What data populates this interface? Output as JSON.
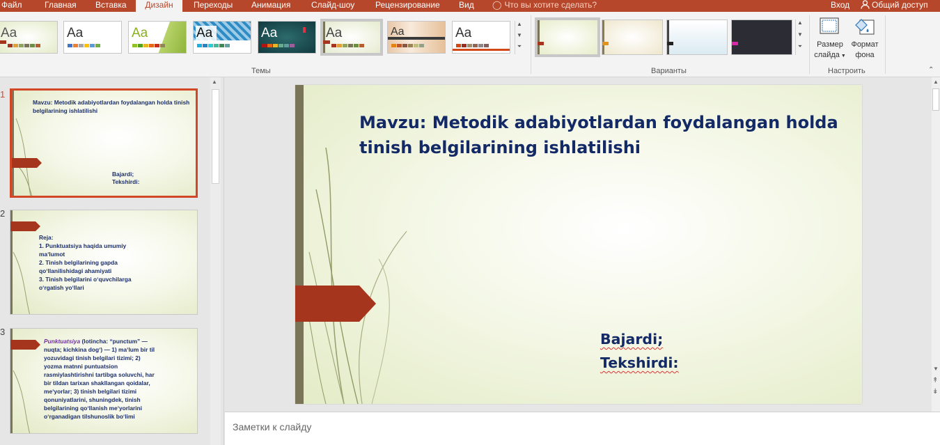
{
  "tabs": [
    {
      "label": "Файл",
      "active": false
    },
    {
      "label": "Главная",
      "active": false
    },
    {
      "label": "Вставка",
      "active": false
    },
    {
      "label": "Дизайн",
      "active": true
    },
    {
      "label": "Переходы",
      "active": false
    },
    {
      "label": "Анимация",
      "active": false
    },
    {
      "label": "Слайд-шоу",
      "active": false
    },
    {
      "label": "Рецензирование",
      "active": false
    },
    {
      "label": "Вид",
      "active": false
    }
  ],
  "tell_me": "Что вы хотите сделать?",
  "sign_in": "Вход",
  "share": "Общий доступ",
  "ribbon": {
    "themes_label": "Темы",
    "variants_label": "Варианты",
    "customize_label": "Настроить",
    "theme_sample": "Aa",
    "slide_size": {
      "line1": "Размер",
      "line2": "слайда"
    },
    "format_bg": {
      "line1": "Формат",
      "line2": "фона"
    }
  },
  "slides": [
    {
      "number": "1",
      "title": "Mavzu: Metodik adabiyotlardan foydalangan holda tinish belgilarining ishlatilishi",
      "subtitle_lines": [
        "Bajardi;",
        "Tekshirdi:"
      ]
    },
    {
      "number": "2",
      "lines": [
        "Reja:",
        "1. Punktuatsiya haqida umumiy",
        "maʼlumot",
        "2. Tinish belgilarining gapda",
        "qoʻllanilishidagi ahamiyati",
        "3. Tinish belgilarini oʻquvchilarga",
        "oʻrgatish yoʻllari"
      ]
    },
    {
      "number": "3",
      "lead": "Punktuatsiya",
      "lines_first": " (lotincha: “punctum” —",
      "lines": [
        "nuqta; kichkina dogʻ) — 1) maʼlum bir til",
        "yozuvidagi tinish belgilari tizimi; 2)",
        "yozma matnni puntuatsion",
        "rasmiylashtirishni tartibga soluvchi, har",
        "bir tildan tarixan shakllangan qoidalar,",
        "meʼyorlar; 3) tinish belgilari tizimi",
        "qonuniyatlarini, shuningdek, tinish",
        "belgilarining qoʻllanish meʼyorlarini",
        "oʻrganadigan tilshunoslik boʻlimi"
      ]
    }
  ],
  "main_slide": {
    "title_line1": "Mavzu: Metodik adabiyotlardan foydalangan holda",
    "title_line2": "tinish belgilarining ishlatilishi",
    "sub_line1": "Bajardi;",
    "sub_line2": "Tekshirdi:"
  },
  "notes_placeholder": "Заметки к слайду",
  "colors": {
    "accent": "#b7472a",
    "slide_title": "#132a66",
    "arrow": "#a5351c",
    "bar": "#7a7558"
  }
}
